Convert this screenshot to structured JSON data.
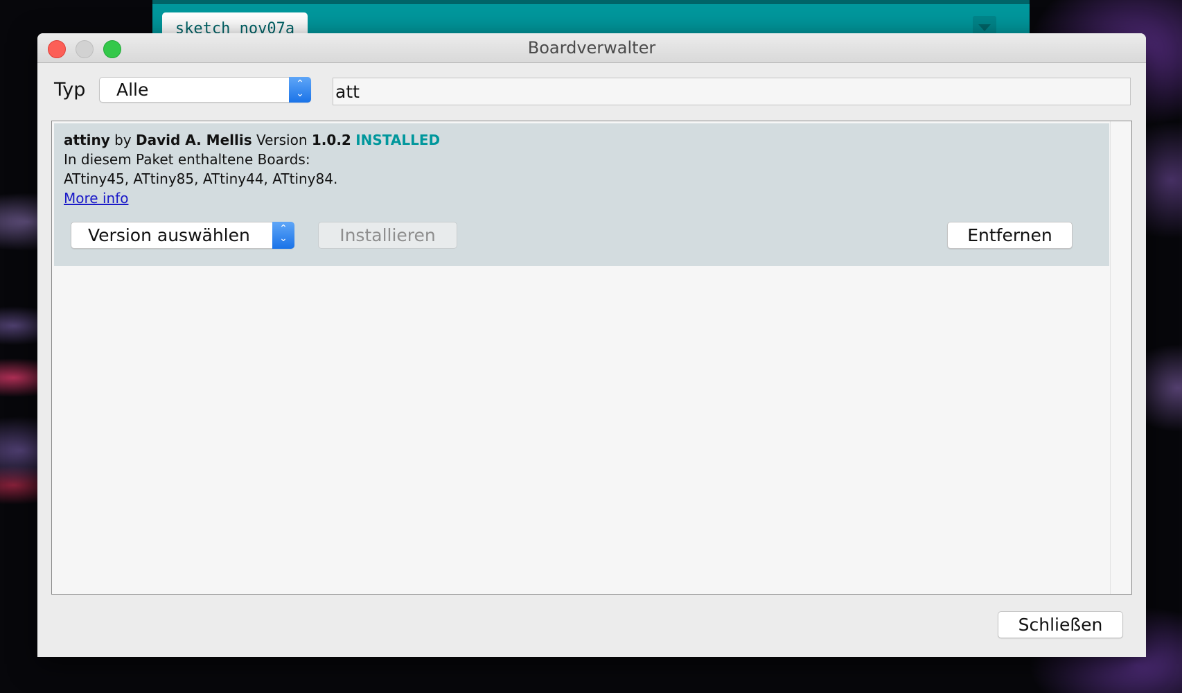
{
  "ide": {
    "tab_label": "sketch_nov07a"
  },
  "dialog": {
    "title": "Boardverwalter"
  },
  "filter": {
    "type_label": "Typ",
    "type_value": "Alle",
    "search_value": "att"
  },
  "boards": [
    {
      "name": "attiny",
      "by": "by",
      "author": "David A. Mellis",
      "version_label": "Version",
      "version": "1.0.2",
      "status": "INSTALLED",
      "boards_heading": "In diesem Paket enthaltene Boards:",
      "boards_list": "ATtiny45, ATtiny85, ATtiny44, ATtiny84.",
      "more_info": "More info",
      "version_select_label": "Version auswählen",
      "install_label": "Installieren",
      "remove_label": "Entfernen"
    }
  ],
  "footer": {
    "close_label": "Schließen"
  },
  "colors": {
    "installed": "#00979c",
    "ide_teal": "#00979c",
    "link": "#1a19c8",
    "entry_bg": "#d3dcdf",
    "stepper_blue": "#1a73e8"
  },
  "icons": {
    "stepper": "up-down-chevron-icon",
    "ide_menu": "triangle-down-icon"
  }
}
